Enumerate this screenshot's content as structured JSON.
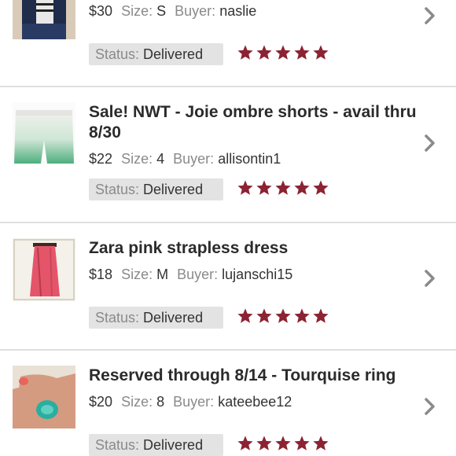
{
  "labels": {
    "size": "Size:",
    "buyer": "Buyer:",
    "status": "Status:"
  },
  "colors": {
    "star": "#8b2332",
    "chevron": "#8a8a8a",
    "status_bg": "#e3e3e3",
    "divider": "#e0e0e0"
  },
  "orders": [
    {
      "title_lines": [],
      "price": "$30",
      "size": "S",
      "buyer": "naslie",
      "status": "Delivered",
      "rating": 5,
      "thumb": "striped-top-photo"
    },
    {
      "title_lines": [
        "Sale! NWT - Joie ombre shorts - avail thru",
        "8/30"
      ],
      "price": "$22",
      "size": "4",
      "buyer": "allisontin1",
      "status": "Delivered",
      "rating": 5,
      "thumb": "ombre-shorts-photo"
    },
    {
      "title_lines": [
        "Zara pink strapless dress"
      ],
      "price": "$18",
      "size": "M",
      "buyer": "lujanschi15",
      "status": "Delivered",
      "rating": 5,
      "thumb": "pink-dress-photo"
    },
    {
      "title_lines": [
        "Reserved through 8/14 - Tourquise ring"
      ],
      "price": "$20",
      "size": "8",
      "buyer": "kateebee12",
      "status": "Delivered",
      "rating": 5,
      "thumb": "turquoise-ring-photo"
    }
  ]
}
